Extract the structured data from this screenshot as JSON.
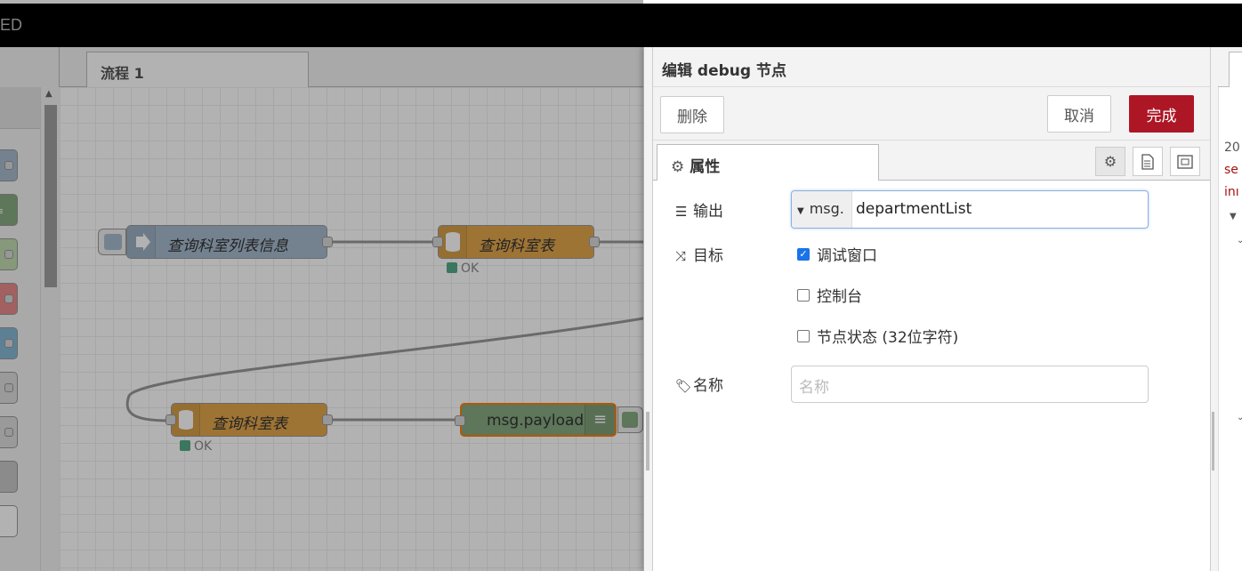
{
  "header": {
    "title": "ED"
  },
  "workspace": {
    "tab_label": "流程 1",
    "nodes": [
      {
        "label": "查询科室列表信息"
      },
      {
        "label": "查询科室表",
        "status": "OK"
      },
      {
        "label": "查询科室表",
        "status": "OK"
      },
      {
        "label": "msg.payload"
      }
    ]
  },
  "tray": {
    "title": "编辑 debug 节点",
    "delete_label": "删除",
    "cancel_label": "取消",
    "done_label": "完成",
    "properties_tab": "属性",
    "output_label": "输出",
    "output_type": "msg.",
    "output_value": "departmentList",
    "target_label": "目标",
    "target_debug_window": "调试窗口",
    "target_console": "控制台",
    "target_node_status": "节点状态 (32位字符)",
    "name_label": "名称",
    "name_placeholder": "名称"
  },
  "sidebar": {
    "line1": "20",
    "line2": "se",
    "line3": "inı"
  },
  "colors": {
    "done_button": "#ad1625",
    "function_node": "#e2a74c",
    "inject_node": "#a6bbcf",
    "debug_node": "#87a980"
  }
}
